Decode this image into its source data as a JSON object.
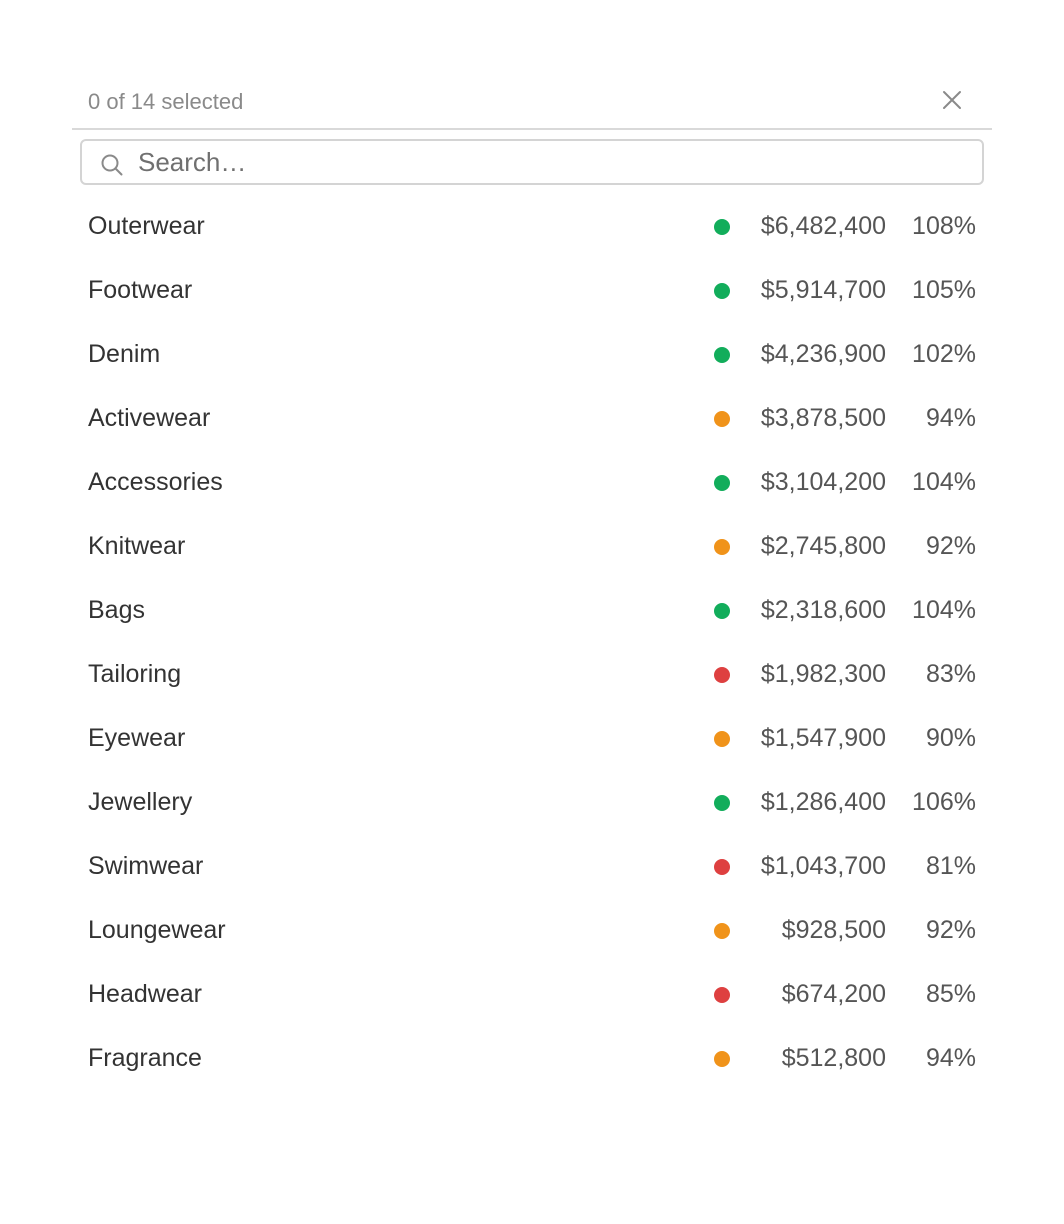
{
  "header": {
    "selected_text": "0 of 14 selected",
    "close_icon": "close-icon"
  },
  "search": {
    "placeholder": "Search…",
    "value": "",
    "icon": "search-icon"
  },
  "status_colors": {
    "green": "#12ad5b",
    "orange": "#f0931a",
    "red": "#de4040"
  },
  "items": [
    {
      "label": "Outerwear",
      "status": "green",
      "value": "$6,482,400",
      "pct": "108%"
    },
    {
      "label": "Footwear",
      "status": "green",
      "value": "$5,914,700",
      "pct": "105%"
    },
    {
      "label": "Denim",
      "status": "green",
      "value": "$4,236,900",
      "pct": "102%"
    },
    {
      "label": "Activewear",
      "status": "orange",
      "value": "$3,878,500",
      "pct": "94%"
    },
    {
      "label": "Accessories",
      "status": "green",
      "value": "$3,104,200",
      "pct": "104%"
    },
    {
      "label": "Knitwear",
      "status": "orange",
      "value": "$2,745,800",
      "pct": "92%"
    },
    {
      "label": "Bags",
      "status": "green",
      "value": "$2,318,600",
      "pct": "104%"
    },
    {
      "label": "Tailoring",
      "status": "red",
      "value": "$1,982,300",
      "pct": "83%"
    },
    {
      "label": "Eyewear",
      "status": "orange",
      "value": "$1,547,900",
      "pct": "90%"
    },
    {
      "label": "Jewellery",
      "status": "green",
      "value": "$1,286,400",
      "pct": "106%"
    },
    {
      "label": "Swimwear",
      "status": "red",
      "value": "$1,043,700",
      "pct": "81%"
    },
    {
      "label": "Loungewear",
      "status": "orange",
      "value": "$928,500",
      "pct": "92%"
    },
    {
      "label": "Headwear",
      "status": "red",
      "value": "$674,200",
      "pct": "85%"
    },
    {
      "label": "Fragrance",
      "status": "orange",
      "value": "$512,800",
      "pct": "94%"
    }
  ]
}
